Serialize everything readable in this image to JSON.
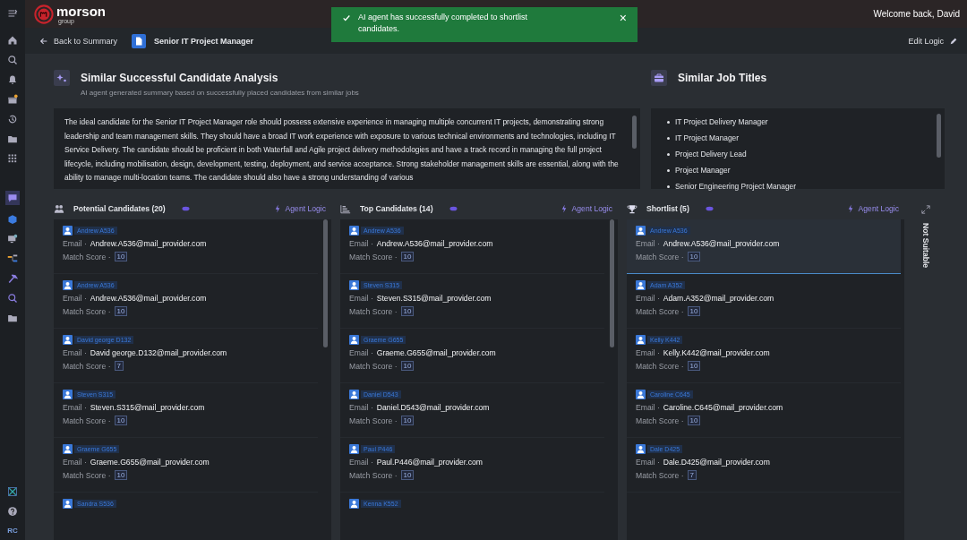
{
  "sidebar": {
    "user_initials": "RC"
  },
  "header": {
    "logo_text": "morson",
    "logo_subtext": "group",
    "welcome": "Welcome back, David"
  },
  "toast": {
    "message": "AI agent has successfully completed to shortlist candidates.",
    "close": "×"
  },
  "subheader": {
    "back": "Back to Summary",
    "job_title": "Senior IT Project Manager",
    "edit": "Edit Logic"
  },
  "analysis": {
    "title": "Similar Successful Candidate Analysis",
    "subtitle": "AI agent generated summary based on successfully placed candidates from similar jobs",
    "text": "The ideal candidate for the Senior IT Project Manager role should possess extensive experience in managing multiple concurrent IT projects, demonstrating strong leadership and team management skills. They should have a broad IT work experience with exposure to various technical environments and technologies, including IT Service Delivery. The candidate should be proficient in both Waterfall and Agile project delivery methodologies and have a track record in managing the full project lifecycle, including mobilisation, design, development, testing, deployment, and service acceptance. Strong stakeholder management skills are essential, along with the ability to manage multi-location teams. The candidate should also have a strong understanding of various"
  },
  "job_titles": {
    "title": "Similar Job Titles",
    "items": [
      "IT Project Delivery Manager",
      "IT Project Manager",
      "Project Delivery Lead",
      "Project Manager",
      "Senior Engineering Project Manager"
    ]
  },
  "columns": [
    {
      "kind": "people",
      "title": "Potential Candidates (20)",
      "agent_logic": "Agent Logic",
      "cards": [
        {
          "name": "Andrew A536",
          "email_label": "Email ·",
          "email": "Andrew.A536@mail_provider.com",
          "score_label": "Match Score ·",
          "score": "10",
          "highlighted": false
        },
        {
          "name": "Andrew A536",
          "email_label": "Email ·",
          "email": "Andrew.A536@mail_provider.com",
          "score_label": "Match Score ·",
          "score": "10",
          "highlighted": false
        },
        {
          "name": "David george D132",
          "email_label": "Email ·",
          "email": "David george.D132@mail_provider.com",
          "score_label": "Match Score ·",
          "score": "7",
          "highlighted": false
        },
        {
          "name": "Steven S315",
          "email_label": "Email ·",
          "email": "Steven.S315@mail_provider.com",
          "score_label": "Match Score ·",
          "score": "10",
          "highlighted": false
        },
        {
          "name": "Graeme G655",
          "email_label": "Email ·",
          "email": "Graeme.G655@mail_provider.com",
          "score_label": "Match Score ·",
          "score": "10",
          "highlighted": false
        },
        {
          "name": "Sandra S536",
          "highlighted": false
        }
      ]
    },
    {
      "kind": "ranked",
      "title": "Top Candidates (14)",
      "agent_logic": "Agent Logic",
      "cards": [
        {
          "name": "Andrew A536",
          "email_label": "Email ·",
          "email": "Andrew.A536@mail_provider.com",
          "score_label": "Match Score ·",
          "score": "10",
          "highlighted": false
        },
        {
          "name": "Steven S315",
          "email_label": "Email ·",
          "email": "Steven.S315@mail_provider.com",
          "score_label": "Match Score ·",
          "score": "10",
          "highlighted": false
        },
        {
          "name": "Graeme G655",
          "email_label": "Email ·",
          "email": "Graeme.G655@mail_provider.com",
          "score_label": "Match Score ·",
          "score": "10",
          "highlighted": false
        },
        {
          "name": "Daniel D543",
          "email_label": "Email ·",
          "email": "Daniel.D543@mail_provider.com",
          "score_label": "Match Score ·",
          "score": "10",
          "highlighted": false
        },
        {
          "name": "Paul P446",
          "email_label": "Email ·",
          "email": "Paul.P446@mail_provider.com",
          "score_label": "Match Score ·",
          "score": "10",
          "highlighted": false
        },
        {
          "name": "Kenna K552",
          "highlighted": false
        }
      ]
    },
    {
      "kind": "trophy",
      "title": "Shortlist (5)",
      "agent_logic": "Agent Logic",
      "cards": [
        {
          "name": "Andrew A536",
          "email_label": "Email ·",
          "email": "Andrew.A536@mail_provider.com",
          "score_label": "Match Score ·",
          "score": "10",
          "highlighted": true
        },
        {
          "name": "Adam A352",
          "email_label": "Email ·",
          "email": "Adam.A352@mail_provider.com",
          "score_label": "Match Score ·",
          "score": "10",
          "highlighted": false
        },
        {
          "name": "Kelly K442",
          "email_label": "Email ·",
          "email": "Kelly.K442@mail_provider.com",
          "score_label": "Match Score ·",
          "score": "10",
          "highlighted": false
        },
        {
          "name": "Caroline C645",
          "email_label": "Email ·",
          "email": "Caroline.C645@mail_provider.com",
          "score_label": "Match Score ·",
          "score": "10",
          "highlighted": false
        },
        {
          "name": "Dale D425",
          "email_label": "Email ·",
          "email": "Dale.D425@mail_provider.com",
          "score_label": "Match Score ·",
          "score": "7",
          "highlighted": false
        }
      ]
    }
  ],
  "not_suitable": {
    "label": "Not Suitable"
  }
}
